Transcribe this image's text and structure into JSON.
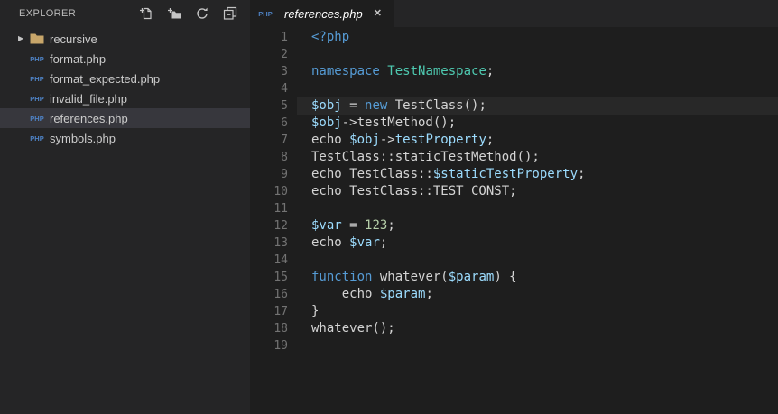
{
  "sidebar": {
    "title": "EXPLORER",
    "file_icon_text": "PHP",
    "actions": [
      {
        "name": "new-file"
      },
      {
        "name": "new-folder"
      },
      {
        "name": "refresh"
      },
      {
        "name": "collapse-all"
      }
    ],
    "items": [
      {
        "label": "recursive",
        "type": "folder",
        "expanded": false,
        "selected": false
      },
      {
        "label": "format.php",
        "type": "php-file",
        "selected": false
      },
      {
        "label": "format_expected.php",
        "type": "php-file",
        "selected": false
      },
      {
        "label": "invalid_file.php",
        "type": "php-file",
        "selected": false
      },
      {
        "label": "references.php",
        "type": "php-file",
        "selected": true
      },
      {
        "label": "symbols.php",
        "type": "php-file",
        "selected": false
      }
    ]
  },
  "tabbar": {
    "tabs": [
      {
        "label": "references.php",
        "icon_text": "PHP",
        "close_glyph": "✕",
        "preview": true,
        "active": true
      }
    ]
  },
  "editor": {
    "language": "php",
    "current_line": 5,
    "lines": [
      {
        "num": "1",
        "tokens": [
          [
            "kw",
            "<?php"
          ]
        ]
      },
      {
        "num": "2",
        "tokens": []
      },
      {
        "num": "3",
        "tokens": [
          [
            "kw",
            "namespace"
          ],
          [
            "pl",
            " "
          ],
          [
            "cls",
            "TestNamespace"
          ],
          [
            "pl",
            ";"
          ]
        ]
      },
      {
        "num": "4",
        "tokens": []
      },
      {
        "num": "5",
        "tokens": [
          [
            "var",
            "$obj"
          ],
          [
            "pl",
            " = "
          ],
          [
            "kw",
            "new"
          ],
          [
            "pl",
            " TestClass();"
          ]
        ]
      },
      {
        "num": "6",
        "tokens": [
          [
            "var",
            "$obj"
          ],
          [
            "pl",
            "->testMethod();"
          ]
        ]
      },
      {
        "num": "7",
        "tokens": [
          [
            "pl",
            "echo "
          ],
          [
            "var",
            "$obj"
          ],
          [
            "pl",
            "->"
          ],
          [
            "var",
            "testProperty"
          ],
          [
            "pl",
            ";"
          ]
        ]
      },
      {
        "num": "8",
        "tokens": [
          [
            "pl",
            "TestClass::staticTestMethod();"
          ]
        ]
      },
      {
        "num": "9",
        "tokens": [
          [
            "pl",
            "echo TestClass::"
          ],
          [
            "var",
            "$staticTestProperty"
          ],
          [
            "pl",
            ";"
          ]
        ]
      },
      {
        "num": "10",
        "tokens": [
          [
            "pl",
            "echo TestClass::TEST_CONST;"
          ]
        ]
      },
      {
        "num": "11",
        "tokens": []
      },
      {
        "num": "12",
        "tokens": [
          [
            "var",
            "$var"
          ],
          [
            "pl",
            " = "
          ],
          [
            "num",
            "123"
          ],
          [
            "pl",
            ";"
          ]
        ]
      },
      {
        "num": "13",
        "tokens": [
          [
            "pl",
            "echo "
          ],
          [
            "var",
            "$var"
          ],
          [
            "pl",
            ";"
          ]
        ]
      },
      {
        "num": "14",
        "tokens": []
      },
      {
        "num": "15",
        "tokens": [
          [
            "kw",
            "function"
          ],
          [
            "pl",
            " whatever("
          ],
          [
            "var",
            "$param"
          ],
          [
            "pl",
            ") {"
          ]
        ]
      },
      {
        "num": "16",
        "tokens": [
          [
            "pl",
            "    echo "
          ],
          [
            "var",
            "$param"
          ],
          [
            "pl",
            ";"
          ]
        ]
      },
      {
        "num": "17",
        "tokens": [
          [
            "pl",
            "}"
          ]
        ]
      },
      {
        "num": "18",
        "tokens": [
          [
            "pl",
            "whatever();"
          ]
        ]
      },
      {
        "num": "19",
        "tokens": []
      }
    ]
  },
  "colors": {
    "sidebar_bg": "#252526",
    "editor_bg": "#1e1e1e",
    "tabbar_bg": "#252526",
    "tab_active_bg": "#1e1e1e",
    "selected_item_bg": "#37373d",
    "current_line_bg": "#282828",
    "keyword": "#569cd6",
    "class_name": "#4ec9b0",
    "variable": "#9cdcfe",
    "number": "#b5cea8",
    "code_text": "#d4d4d4",
    "line_number": "#737373",
    "sidebar_text": "#cccccc",
    "title_text": "#bbbbbb",
    "icon_gray": "#c5c5c5",
    "php_icon_blue": "#4e82c4",
    "folder_tan": "#c8a66a",
    "tab_text": "#ffffff"
  }
}
